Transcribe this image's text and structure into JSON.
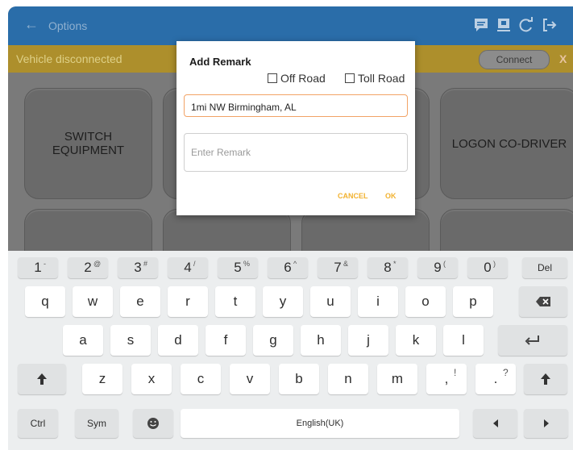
{
  "appbar": {
    "title": "Options",
    "back_icon": "arrow-left-icon"
  },
  "vehicle_bar": {
    "message": "Vehicle disconnected",
    "connect_label": "Connect",
    "close_label": "X"
  },
  "tiles": {
    "switch_equipment": "SWITCH EQUIPMENT",
    "logon_codriver": "LOGON CO-DRIVER"
  },
  "dialog": {
    "title": "Add Remark",
    "off_road_label": "Off Road",
    "toll_road_label": "Toll Road",
    "location_value": "1mi NW Birmingham, AL",
    "remark_placeholder": "Enter Remark",
    "cancel_label": "CANCEL",
    "ok_label": "OK"
  },
  "keyboard": {
    "number_row": [
      {
        "k": "1",
        "s": "-"
      },
      {
        "k": "2",
        "s": "@"
      },
      {
        "k": "3",
        "s": "#"
      },
      {
        "k": "4",
        "s": "/"
      },
      {
        "k": "5",
        "s": "%"
      },
      {
        "k": "6",
        "s": "^"
      },
      {
        "k": "7",
        "s": "&"
      },
      {
        "k": "8",
        "s": "*"
      },
      {
        "k": "9",
        "s": "("
      },
      {
        "k": "0",
        "s": ")"
      }
    ],
    "del_label": "Del",
    "row1": [
      "q",
      "w",
      "e",
      "r",
      "t",
      "y",
      "u",
      "i",
      "o",
      "p"
    ],
    "row2": [
      "a",
      "s",
      "d",
      "f",
      "g",
      "h",
      "j",
      "k",
      "l"
    ],
    "row3": [
      "z",
      "x",
      "c",
      "v",
      "b",
      "n",
      "m"
    ],
    "comma": ",",
    "comma_sup": "!",
    "period": ".",
    "period_sup": "?",
    "ctrl_label": "Ctrl",
    "sym_label": "Sym",
    "space_label": "English(UK)",
    "colors": {
      "appbar": "#2a6da9",
      "vehicle_bar": "#ad8f2c",
      "accent": "#f2b230",
      "input_focus": "#f2a366"
    }
  }
}
